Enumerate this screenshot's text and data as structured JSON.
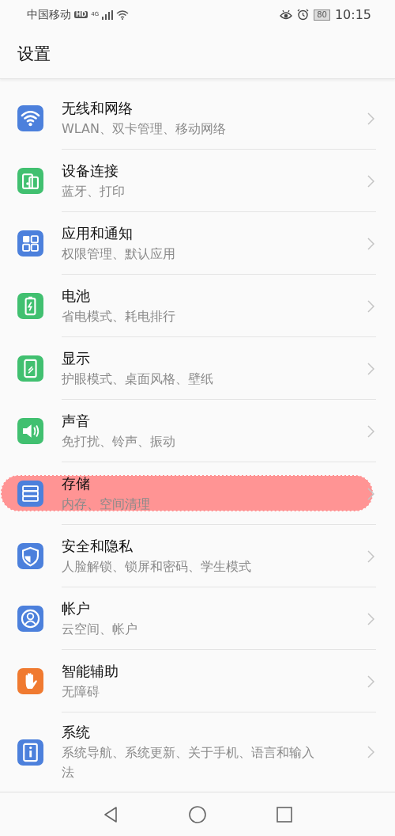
{
  "status_bar": {
    "carrier": "中国移动",
    "hd_badge": "HD",
    "network": "4G",
    "battery": "80",
    "time": "10:15"
  },
  "header": {
    "title": "设置"
  },
  "items": [
    {
      "title": "无线和网络",
      "subtitle": "WLAN、双卡管理、移动网络",
      "color": "#4c80dc",
      "highlighted": false
    },
    {
      "title": "设备连接",
      "subtitle": "蓝牙、打印",
      "color": "#41c070",
      "highlighted": false
    },
    {
      "title": "应用和通知",
      "subtitle": "权限管理、默认应用",
      "color": "#4c80dc",
      "highlighted": false
    },
    {
      "title": "电池",
      "subtitle": "省电模式、耗电排行",
      "color": "#41c070",
      "highlighted": false
    },
    {
      "title": "显示",
      "subtitle": "护眼模式、桌面风格、壁纸",
      "color": "#41c070",
      "highlighted": false
    },
    {
      "title": "声音",
      "subtitle": "免打扰、铃声、振动",
      "color": "#41c070",
      "highlighted": false
    },
    {
      "title": "存储",
      "subtitle": "内存、空间清理",
      "color": "#4c80dc",
      "highlighted": true
    },
    {
      "title": "安全和隐私",
      "subtitle": "人脸解锁、锁屏和密码、学生模式",
      "color": "#4c80dc",
      "highlighted": false
    },
    {
      "title": "帐户",
      "subtitle": "云空间、帐户",
      "color": "#4c80dc",
      "highlighted": false
    },
    {
      "title": "智能辅助",
      "subtitle": "无障碍",
      "color": "#f07a30",
      "highlighted": false
    },
    {
      "title": "系统",
      "subtitle": "系统导航、系统更新、关于手机、语言和输入法",
      "color": "#4c80dc",
      "highlighted": false
    }
  ]
}
